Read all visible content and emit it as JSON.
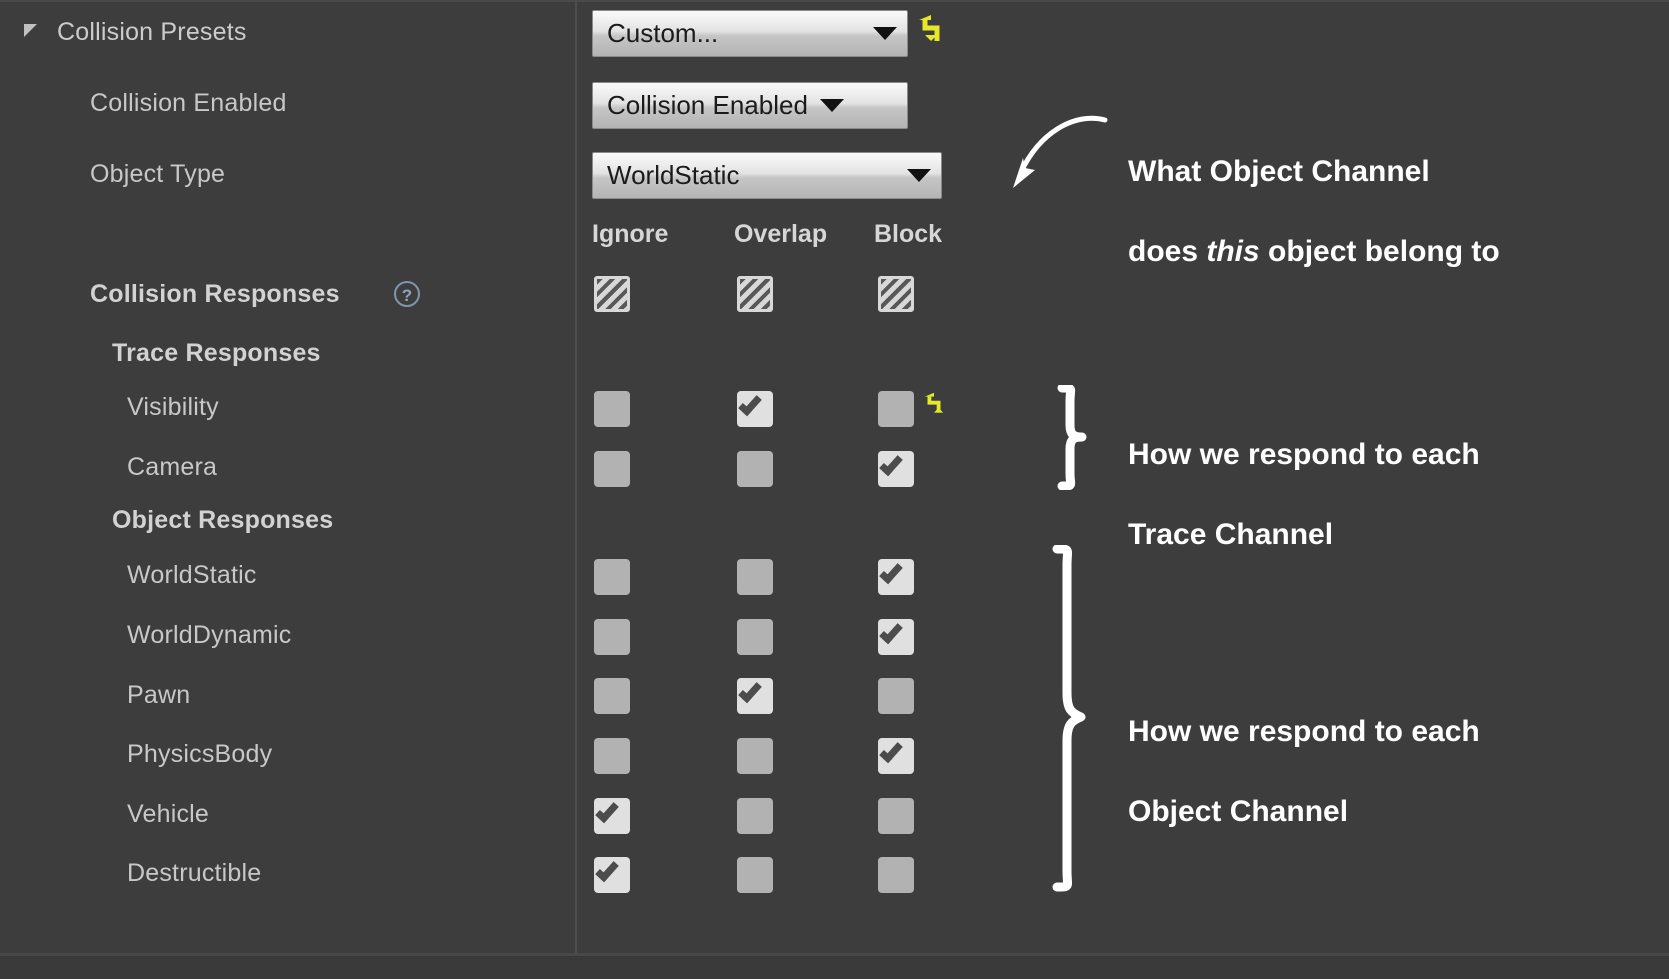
{
  "panel": {
    "section_header": "Collision Presets",
    "expander_icon": "triangle-expanded-icon",
    "rows": [
      {
        "label": "Collision Enabled"
      },
      {
        "label": "Object Type"
      }
    ],
    "collision_responses_label": "Collision Responses",
    "help_icon": "question-mark-circle-icon",
    "trace_responses_label": "Trace Responses",
    "object_responses_label": "Object Responses"
  },
  "combos": {
    "preset": {
      "value": "Custom...",
      "caret_icon": "chevron-down-icon",
      "reset_icon": "reset-arrow-icon"
    },
    "collision_enabled": {
      "value": "Collision Enabled",
      "caret_icon": "chevron-down-icon"
    },
    "object_type": {
      "value": "WorldStatic",
      "caret_icon": "chevron-down-icon"
    }
  },
  "columns": [
    "Ignore",
    "Overlap",
    "Block"
  ],
  "summary_row": {
    "label": "Collision Responses",
    "states": [
      "hatched",
      "hatched",
      "hatched"
    ]
  },
  "trace_responses": [
    {
      "label": "Visibility",
      "ignore": false,
      "overlap": true,
      "block": false,
      "reset_icon": "reset-arrow-icon"
    },
    {
      "label": "Camera",
      "ignore": false,
      "overlap": false,
      "block": true
    }
  ],
  "object_responses": [
    {
      "label": "WorldStatic",
      "ignore": false,
      "overlap": false,
      "block": true
    },
    {
      "label": "WorldDynamic",
      "ignore": false,
      "overlap": false,
      "block": true
    },
    {
      "label": "Pawn",
      "ignore": false,
      "overlap": true,
      "block": false
    },
    {
      "label": "PhysicsBody",
      "ignore": false,
      "overlap": false,
      "block": true
    },
    {
      "label": "Vehicle",
      "ignore": true,
      "overlap": false,
      "block": false
    },
    {
      "label": "Destructible",
      "ignore": true,
      "overlap": false,
      "block": false
    }
  ],
  "annotations": {
    "object_channel": {
      "line1": "What Object Channel",
      "line2_a": "does ",
      "line2_i": "this",
      "line2_b": " object belong to"
    },
    "trace_channel": {
      "line1": "How we respond to each",
      "line2": "Trace Channel"
    },
    "object_channel_group": {
      "line1": "How we respond to each",
      "line2": "Object Channel"
    }
  },
  "colors": {
    "background": "#3d3d3d",
    "label_text": "#c8c8c8",
    "annotation_text": "#ffffff",
    "reset_yellow": "#e8e82a",
    "checkbox_on": "#e0e0e0",
    "checkbox_off": "#b2b2b2",
    "help_blue": "#8fa5bb"
  }
}
